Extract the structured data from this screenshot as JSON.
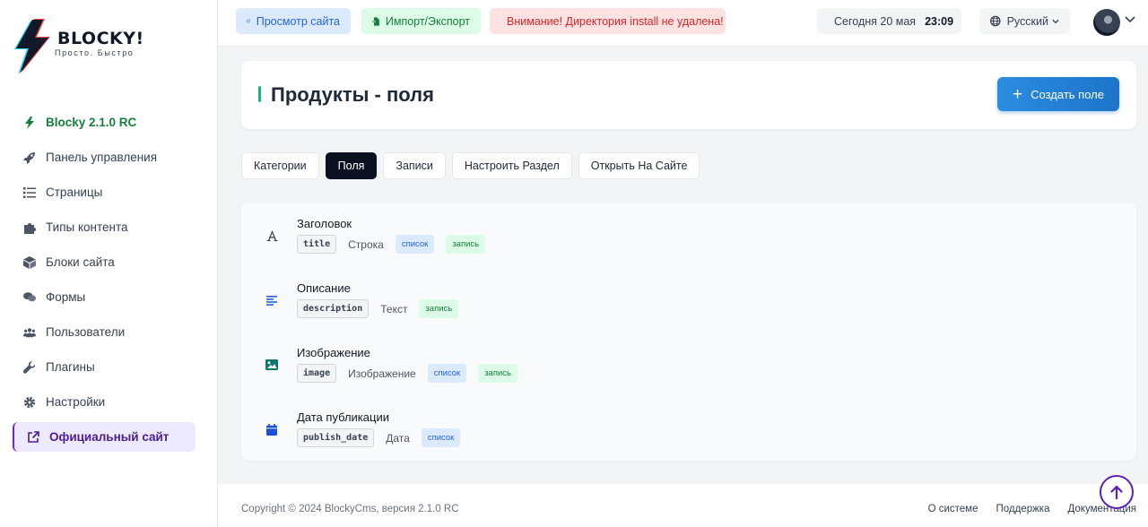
{
  "brand": {
    "name": "BLOCKY!",
    "tagline": "Просто. Быстро",
    "colors": {
      "bolt_dark": "#111827",
      "bolt_red": "#ef4444",
      "bolt_cyan": "#22d3ee"
    }
  },
  "sidebar": {
    "items": [
      {
        "label": "Blocky 2.1.0 RC",
        "icon": "bolt-icon"
      },
      {
        "label": "Панель управления",
        "icon": "rocket-icon"
      },
      {
        "label": "Страницы",
        "icon": "list-icon"
      },
      {
        "label": "Типы контента",
        "icon": "puzzle-icon"
      },
      {
        "label": "Блоки сайта",
        "icon": "cube-icon"
      },
      {
        "label": "Формы",
        "icon": "comments-icon"
      },
      {
        "label": "Пользователи",
        "icon": "users-icon"
      },
      {
        "label": "Плагины",
        "icon": "wrench-icon"
      },
      {
        "label": "Настройки",
        "icon": "gear-icon"
      },
      {
        "label": "Официальный сайт",
        "icon": "external-link-icon"
      }
    ]
  },
  "topbar": {
    "view_site": "Просмотр сайта",
    "import_export": "Импорт/Экспорт",
    "warning": "Внимание! Директория install не удалена!",
    "date": "Сегодня 20 мая",
    "time": "23:09",
    "language": "Русский"
  },
  "page": {
    "title": "Продукты - поля",
    "create_button": "Создать поле"
  },
  "tabs": [
    {
      "label": "Категории",
      "active": false
    },
    {
      "label": "Поля",
      "active": true
    },
    {
      "label": "Записи",
      "active": false
    },
    {
      "label": "Настроить Раздел",
      "active": false
    },
    {
      "label": "Открыть На Сайте",
      "active": false
    }
  ],
  "fields": [
    {
      "name": "Заголовок",
      "key": "title",
      "type": "Строка",
      "icon": "font-icon",
      "badges": [
        "список",
        "запись"
      ]
    },
    {
      "name": "Описание",
      "key": "description",
      "type": "Текст",
      "icon": "align-left-icon",
      "badges": [
        "запись"
      ]
    },
    {
      "name": "Изображение",
      "key": "image",
      "type": "Изображение",
      "icon": "image-icon",
      "badges": [
        "список",
        "запись"
      ]
    },
    {
      "name": "Дата публикации",
      "key": "publish_date",
      "type": "Дата",
      "icon": "calendar-icon",
      "badges": [
        "список"
      ]
    }
  ],
  "footer": {
    "copyright": "Copyright © 2024 BlockyCms, версия 2.1.0 RC",
    "links": [
      "О системе",
      "Поддержка",
      "Документация"
    ]
  },
  "colors": {
    "accent_blue": "#2563eb",
    "accent_green": "#15803d",
    "danger": "#dc2626",
    "active_tab": "#0b1120",
    "active_nav": "#ede9fe"
  }
}
